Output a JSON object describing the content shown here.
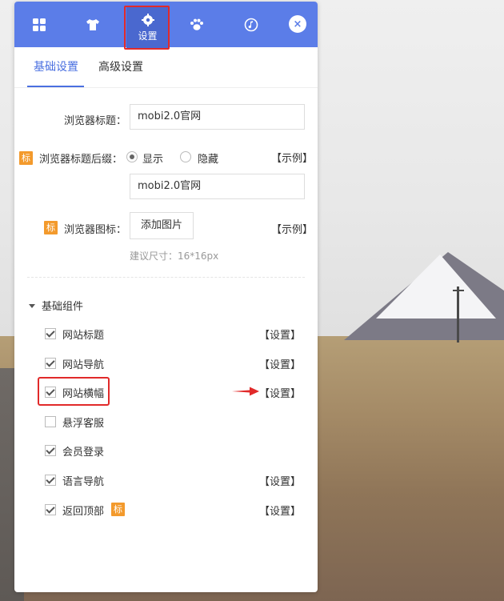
{
  "topbar": {
    "icons": [
      "grid-icon",
      "shirt-icon",
      "gear-icon",
      "paw-icon",
      "music-icon"
    ],
    "settings_label": "设置",
    "close_label": "×"
  },
  "subtabs": [
    {
      "label": "基础设置",
      "active": true
    },
    {
      "label": "高级设置",
      "active": false
    }
  ],
  "form": {
    "browser_title_label": "浏览器标题：",
    "browser_title_value": "mobi2.0官网",
    "suffix_label": "浏览器标题后缀：",
    "suffix_options": [
      {
        "label": "显示",
        "selected": true
      },
      {
        "label": "隐藏",
        "selected": false
      }
    ],
    "suffix_value": "mobi2.0官网",
    "example_link": "【示例】",
    "icon_label": "浏览器图标：",
    "add_image_button": "添加图片",
    "size_hint": "建议尺寸：16*16px",
    "badge_text": "标"
  },
  "components": {
    "section_title": "基础组件",
    "items": [
      {
        "label": "网站标题",
        "checked": true,
        "settings": "【设置】"
      },
      {
        "label": "网站导航",
        "checked": true,
        "settings": "【设置】"
      },
      {
        "label": "网站横幅",
        "checked": true,
        "settings": "【设置】"
      },
      {
        "label": "悬浮客服",
        "checked": false,
        "settings": ""
      },
      {
        "label": "会员登录",
        "checked": true,
        "settings": ""
      },
      {
        "label": "语言导航",
        "checked": true,
        "settings": "【设置】"
      },
      {
        "label": "返回顶部",
        "checked": true,
        "settings": "【设置】",
        "badge": "标"
      }
    ]
  },
  "colors": {
    "accent": "#5b7de8",
    "badge": "#f39a2c",
    "highlight": "#e12a2a"
  }
}
